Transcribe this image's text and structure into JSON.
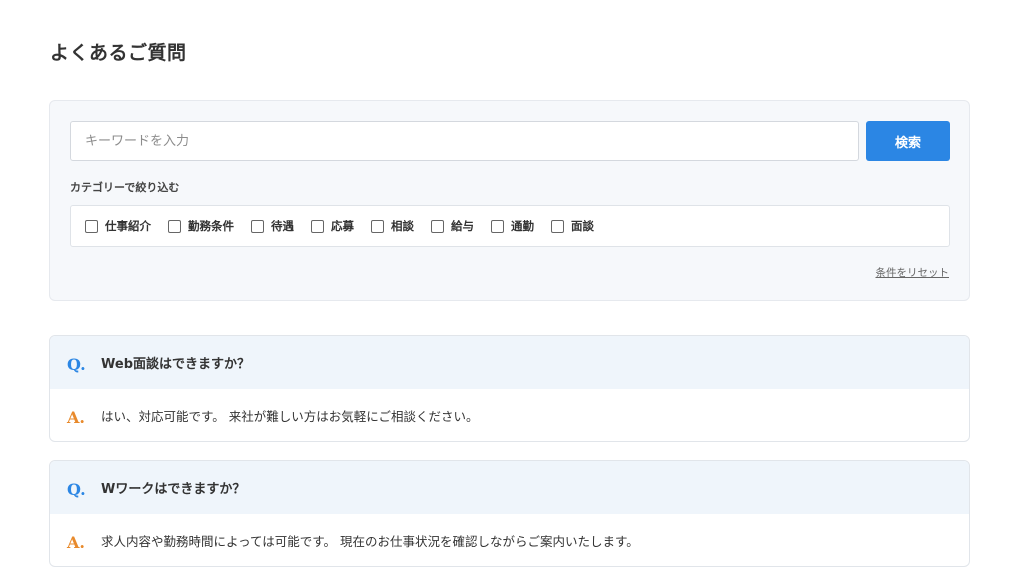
{
  "page": {
    "title": "よくあるご質問"
  },
  "search": {
    "placeholder": "キーワードを入力",
    "value": "",
    "button_label": "検索"
  },
  "categories": {
    "heading": "カテゴリーで絞り込む",
    "items": [
      {
        "label": "仕事紹介",
        "checked": false
      },
      {
        "label": "勤務条件",
        "checked": false
      },
      {
        "label": "待遇",
        "checked": false
      },
      {
        "label": "応募",
        "checked": false
      },
      {
        "label": "相談",
        "checked": false
      },
      {
        "label": "給与",
        "checked": false
      },
      {
        "label": "通勤",
        "checked": false
      },
      {
        "label": "面談",
        "checked": false
      }
    ],
    "reset_label": "条件をリセット"
  },
  "faq": [
    {
      "q_mark": "Q.",
      "question": "Web面談はできますか？",
      "a_mark": "A.",
      "answer": "はい、対応可能です。 来社が難しい方はお気軽にご相談ください。"
    },
    {
      "q_mark": "Q.",
      "question": "Wワークはできますか？",
      "a_mark": "A.",
      "answer": "求人内容や勤務時間によっては可能です。 現在のお仕事状況を確認しながらご案内いたします。"
    }
  ],
  "colors": {
    "accent": "#2b86e4",
    "answer_mark": "#e88a2c",
    "question_bg": "#eff5fb",
    "panel_bg": "#f6f8fb"
  }
}
